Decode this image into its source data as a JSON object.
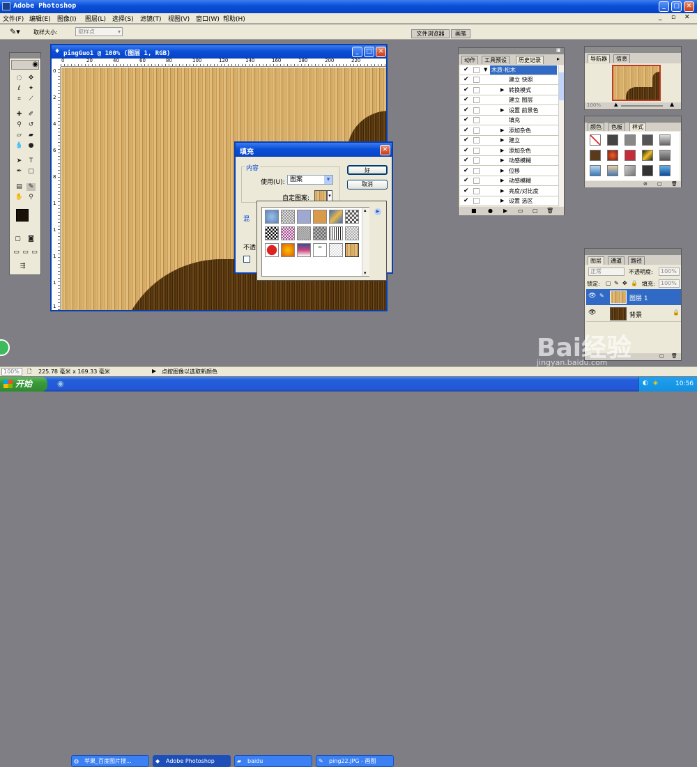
{
  "app": {
    "title": "Adobe Photoshop"
  },
  "menu": [
    "文件(F)",
    "编辑(E)",
    "图像(I)",
    "图层(L)",
    "选择(S)",
    "滤镜(T)",
    "视图(V)",
    "窗口(W)",
    "帮助(H)"
  ],
  "options": {
    "sample_label": "取样大小:",
    "sample_value": "取样点",
    "tab_browser": "文件浏览器",
    "tab_brush": "画笔"
  },
  "doc": {
    "title": "pingGuo1 @ 100% (图层 1, RGB)",
    "ruler": [
      "0",
      "20",
      "40",
      "60",
      "80",
      "100",
      "120",
      "140",
      "160",
      "180",
      "200",
      "220"
    ],
    "vruler": [
      "0",
      "2",
      "4",
      "6",
      "8",
      "1",
      "1",
      "1",
      "1",
      "1"
    ]
  },
  "fill_dialog": {
    "title": "填充",
    "content_label": "内容",
    "use_label": "使用(U):",
    "use_value": "图案",
    "custom_pattern_label": "自定图案:",
    "blend_label": "混",
    "opacity_label": "不透",
    "ok": "好",
    "cancel": "取消"
  },
  "history": {
    "tabs": [
      "动作",
      "工具预设",
      "历史记录"
    ],
    "header": "木质-松木",
    "items": [
      "建立 快照",
      "转换模式",
      "建立 图层",
      "设置 前景色",
      "填充",
      "添加杂色",
      "建立",
      "添加杂色",
      "动感模糊",
      "位移",
      "动感模糊",
      "亮度/对比度",
      "设置 选区"
    ]
  },
  "navigator": {
    "tabs": [
      "导航器",
      "信息"
    ],
    "zoom": "100%"
  },
  "styles": {
    "tabs": [
      "颜色",
      "色板",
      "样式"
    ]
  },
  "layers": {
    "tabs": [
      "图层",
      "通道",
      "路径"
    ],
    "blend": "正常",
    "opacity_label": "不透明度:",
    "opacity": "100%",
    "lock_label": "锁定:",
    "fill_label": "填充:",
    "fill": "100%",
    "items": [
      {
        "name": "图层 1"
      },
      {
        "name": "背景"
      }
    ]
  },
  "status": {
    "zoom": "100%",
    "size": "225.78 毫米 x 169.33 毫米",
    "hint": "点按图像以选取新颜色"
  },
  "taskbar": {
    "start": "开始",
    "items": [
      "苹果_百度图片搜...",
      "Adobe Photoshop",
      "baidu",
      "ping22.JPG - 画图"
    ],
    "clock": "10:56"
  },
  "watermark": {
    "brand": "Bai经验",
    "url": "jingyan.baidu.com"
  },
  "colors": {
    "xp_blue": "#0a4fd8",
    "panel_bg": "#ece9d8",
    "selected": "#316ac5",
    "workspace": "#7e7e84"
  }
}
